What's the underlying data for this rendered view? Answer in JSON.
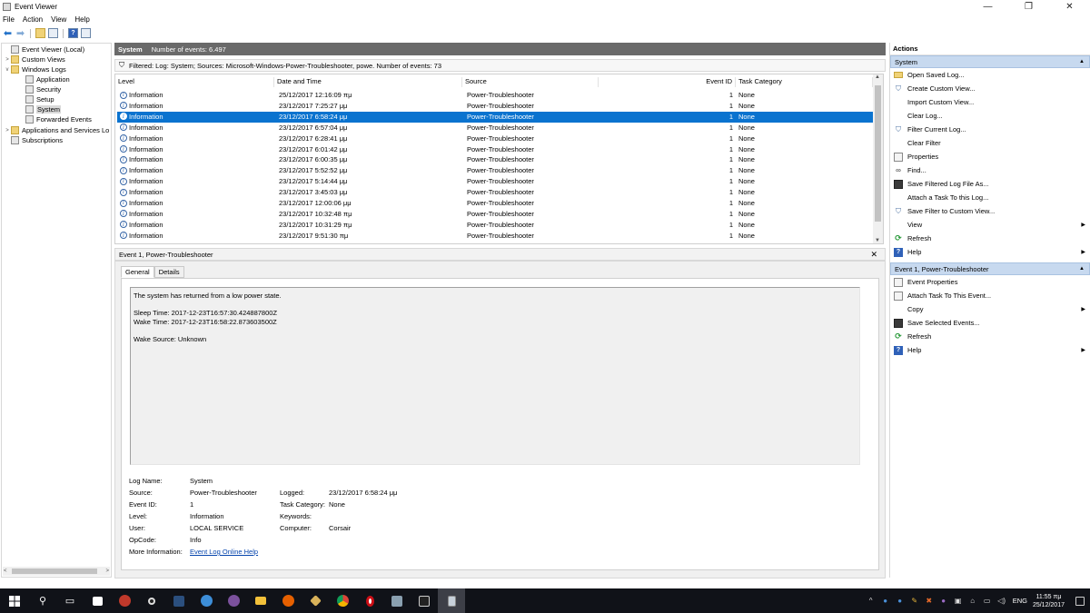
{
  "window": {
    "title": "Event Viewer",
    "controls": [
      "—",
      "❐",
      "✕"
    ]
  },
  "menu": [
    "File",
    "Action",
    "View",
    "Help"
  ],
  "toolbar": {
    "icons": [
      "back-arrow-icon",
      "forward-arrow-icon",
      "folder-up-icon",
      "show-hide-tree-icon",
      "help-icon",
      "properties-icon"
    ]
  },
  "tree": {
    "items": [
      {
        "label": "Event Viewer (Local)",
        "level": 0,
        "expander": "",
        "icon": "computer-icon"
      },
      {
        "label": "Custom Views",
        "level": 1,
        "expander": ">",
        "icon": "folder-icon"
      },
      {
        "label": "Windows Logs",
        "level": 1,
        "expander": "v",
        "icon": "folder-icon"
      },
      {
        "label": "Application",
        "level": 2,
        "expander": "",
        "icon": "log-icon"
      },
      {
        "label": "Security",
        "level": 2,
        "expander": "",
        "icon": "log-icon"
      },
      {
        "label": "Setup",
        "level": 2,
        "expander": "",
        "icon": "log-icon"
      },
      {
        "label": "System",
        "level": 2,
        "expander": "",
        "icon": "log-icon",
        "selected": true
      },
      {
        "label": "Forwarded Events",
        "level": 2,
        "expander": "",
        "icon": "log-icon"
      },
      {
        "label": "Applications and Services Lo",
        "level": 1,
        "expander": ">",
        "icon": "folder-icon"
      },
      {
        "label": "Subscriptions",
        "level": 1,
        "expander": "",
        "icon": "log-icon"
      }
    ]
  },
  "center": {
    "log_name": "System",
    "event_count": "Number of events: 6.497",
    "filter_text": "Filtered: Log: System; Sources: Microsoft-Windows-Power-Troubleshooter, powe. Number of events: 73"
  },
  "events": {
    "columns": [
      "Level",
      "Date and Time",
      "Source",
      "Event ID",
      "Task Category"
    ],
    "rows": [
      {
        "level": "Information",
        "datetime": "25/12/2017 12:16:09 πμ",
        "source": "Power-Troubleshooter",
        "event_id": "1",
        "category": "None"
      },
      {
        "level": "Information",
        "datetime": "23/12/2017 7:25:27 μμ",
        "source": "Power-Troubleshooter",
        "event_id": "1",
        "category": "None"
      },
      {
        "level": "Information",
        "datetime": "23/12/2017 6:58:24 μμ",
        "source": "Power-Troubleshooter",
        "event_id": "1",
        "category": "None",
        "selected": true
      },
      {
        "level": "Information",
        "datetime": "23/12/2017 6:57:04 μμ",
        "source": "Power-Troubleshooter",
        "event_id": "1",
        "category": "None"
      },
      {
        "level": "Information",
        "datetime": "23/12/2017 6:28:41 μμ",
        "source": "Power-Troubleshooter",
        "event_id": "1",
        "category": "None"
      },
      {
        "level": "Information",
        "datetime": "23/12/2017 6:01:42 μμ",
        "source": "Power-Troubleshooter",
        "event_id": "1",
        "category": "None"
      },
      {
        "level": "Information",
        "datetime": "23/12/2017 6:00:35 μμ",
        "source": "Power-Troubleshooter",
        "event_id": "1",
        "category": "None"
      },
      {
        "level": "Information",
        "datetime": "23/12/2017 5:52:52 μμ",
        "source": "Power-Troubleshooter",
        "event_id": "1",
        "category": "None"
      },
      {
        "level": "Information",
        "datetime": "23/12/2017 5:14:44 μμ",
        "source": "Power-Troubleshooter",
        "event_id": "1",
        "category": "None"
      },
      {
        "level": "Information",
        "datetime": "23/12/2017 3:45:03 μμ",
        "source": "Power-Troubleshooter",
        "event_id": "1",
        "category": "None"
      },
      {
        "level": "Information",
        "datetime": "23/12/2017 12:00:06 μμ",
        "source": "Power-Troubleshooter",
        "event_id": "1",
        "category": "None"
      },
      {
        "level": "Information",
        "datetime": "23/12/2017 10:32:48 πμ",
        "source": "Power-Troubleshooter",
        "event_id": "1",
        "category": "None"
      },
      {
        "level": "Information",
        "datetime": "23/12/2017 10:31:29 πμ",
        "source": "Power-Troubleshooter",
        "event_id": "1",
        "category": "None"
      },
      {
        "level": "Information",
        "datetime": "23/12/2017 9:51:30 πμ",
        "source": "Power-Troubleshooter",
        "event_id": "1",
        "category": "None"
      }
    ]
  },
  "detail": {
    "header": "Event 1, Power-Troubleshooter",
    "tabs": [
      "General",
      "Details"
    ],
    "message": {
      "line1": "The system has returned from a low power state.",
      "line2": "Sleep Time: 2017-12-23T16:57:30.424887800Z",
      "line3": "Wake Time: 2017-12-23T16:58:22.873603500Z",
      "line4": "Wake Source: Unknown"
    },
    "props": {
      "log_name_k": "Log Name:",
      "log_name_v": "System",
      "source_k": "Source:",
      "source_v": "Power-Troubleshooter",
      "logged_k": "Logged:",
      "logged_v": "23/12/2017 6:58:24 μμ",
      "event_id_k": "Event ID:",
      "event_id_v": "1",
      "task_cat_k": "Task Category:",
      "task_cat_v": "None",
      "level_k": "Level:",
      "level_v": "Information",
      "keywords_k": "Keywords:",
      "keywords_v": "",
      "user_k": "User:",
      "user_v": "LOCAL SERVICE",
      "computer_k": "Computer:",
      "computer_v": "Corsair",
      "opcode_k": "OpCode:",
      "opcode_v": "Info",
      "more_info_k": "More Information:",
      "more_info_v": "Event Log Online Help"
    }
  },
  "actions": {
    "title": "Actions",
    "section1": "System",
    "section1_items": [
      {
        "label": "Open Saved Log...",
        "icon": "folder-icon"
      },
      {
        "label": "Create Custom View...",
        "icon": "funnel-star-icon"
      },
      {
        "label": "Import Custom View...",
        "icon": "none"
      },
      {
        "label": "Clear Log...",
        "icon": "none"
      },
      {
        "label": "Filter Current Log...",
        "icon": "funnel-icon"
      },
      {
        "label": "Clear Filter",
        "icon": "none"
      },
      {
        "label": "Properties",
        "icon": "properties-icon"
      },
      {
        "label": "Find...",
        "icon": "binoculars-icon"
      },
      {
        "label": "Save Filtered Log File As...",
        "icon": "save-icon"
      },
      {
        "label": "Attach a Task To this Log...",
        "icon": "none"
      },
      {
        "label": "Save Filter to Custom View...",
        "icon": "funnel-icon"
      },
      {
        "label": "View",
        "icon": "none",
        "submenu": true
      },
      {
        "label": "Refresh",
        "icon": "refresh-icon"
      },
      {
        "label": "Help",
        "icon": "help-icon",
        "submenu": true
      }
    ],
    "section2": "Event 1, Power-Troubleshooter",
    "section2_items": [
      {
        "label": "Event Properties",
        "icon": "properties-icon"
      },
      {
        "label": "Attach Task To This Event...",
        "icon": "task-icon"
      },
      {
        "label": "Copy",
        "icon": "copy-icon",
        "submenu": true
      },
      {
        "label": "Save Selected Events...",
        "icon": "save-icon"
      },
      {
        "label": "Refresh",
        "icon": "refresh-icon"
      },
      {
        "label": "Help",
        "icon": "help-icon",
        "submenu": true
      }
    ]
  },
  "taskbar": {
    "apps": [
      "start-icon",
      "search-icon",
      "task-view-icon",
      "store-icon",
      "app-icon",
      "app-icon",
      "app-icon",
      "app-icon",
      "viber-icon",
      "file-explorer-icon",
      "firefox-icon",
      "app-icon",
      "chrome-icon",
      "opera-icon",
      "app-icon",
      "terminal-icon",
      "event-viewer-icon"
    ],
    "lang": "ENG",
    "time": "11:55 πμ",
    "date": "25/12/2017"
  }
}
